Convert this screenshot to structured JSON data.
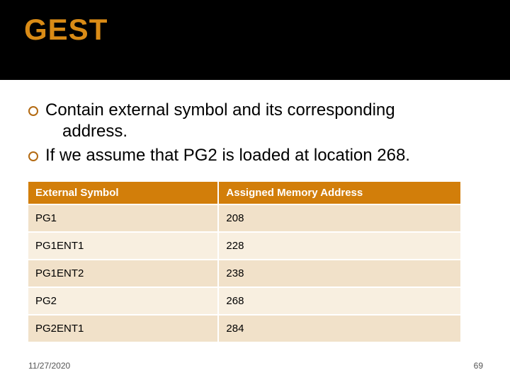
{
  "title": "GEST",
  "bullets": [
    {
      "lines": [
        "Contain external symbol and its corresponding",
        "address."
      ]
    },
    {
      "lines": [
        "If we assume that PG2 is loaded at location 268."
      ]
    }
  ],
  "table": {
    "headers": [
      "External Symbol",
      "Assigned Memory Address"
    ],
    "rows": [
      [
        "PG1",
        "208"
      ],
      [
        "PG1ENT1",
        "228"
      ],
      [
        "PG1ENT2",
        "238"
      ],
      [
        "PG2",
        "268"
      ],
      [
        "PG2ENT1",
        "284"
      ]
    ]
  },
  "footer": {
    "date": "11/27/2020",
    "page": "69"
  }
}
